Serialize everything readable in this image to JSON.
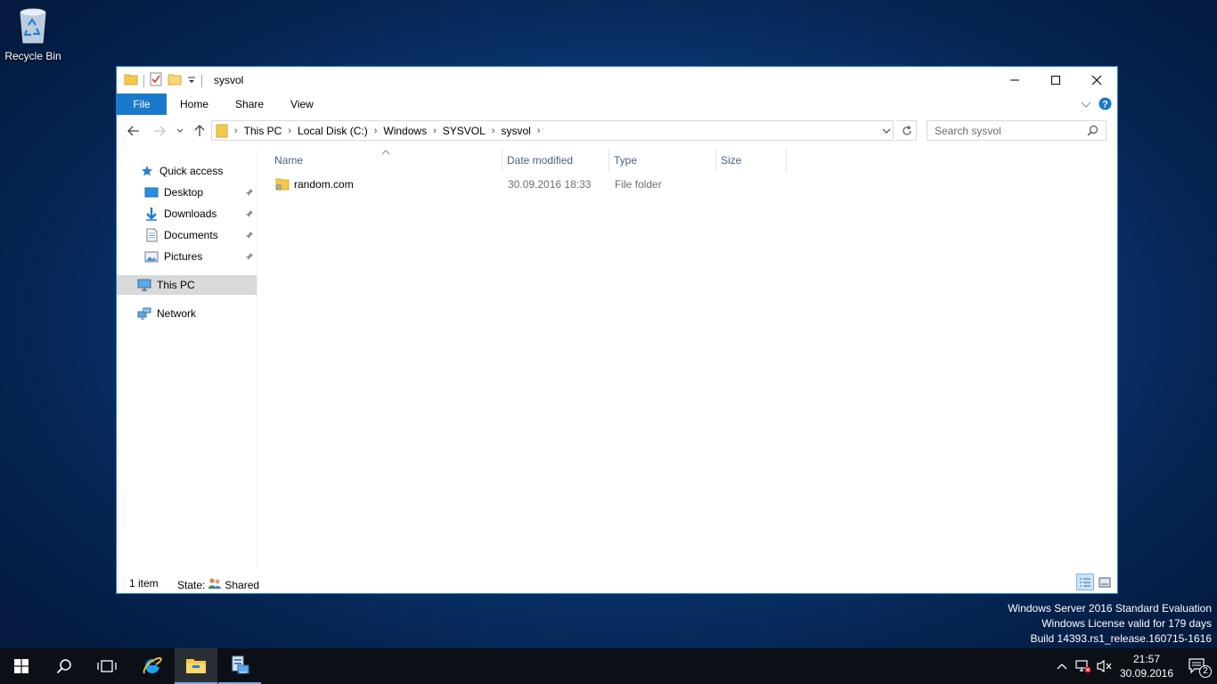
{
  "desktop": {
    "recycle_bin_label": "Recycle Bin",
    "watermark": {
      "line1": "Windows Server 2016 Standard Evaluation",
      "line2": "Windows License valid for 179 days",
      "line3": "Build 14393.rs1_release.160715-1616"
    }
  },
  "window": {
    "title": "sysvol",
    "ribbon_tabs": [
      "File",
      "Home",
      "Share",
      "View"
    ],
    "breadcrumb": [
      "This PC",
      "Local Disk (C:)",
      "Windows",
      "SYSVOL",
      "sysvol"
    ],
    "search_placeholder": "Search sysvol",
    "nav": {
      "quick_access": "Quick access",
      "desktop": "Desktop",
      "downloads": "Downloads",
      "documents": "Documents",
      "pictures": "Pictures",
      "this_pc": "This PC",
      "network": "Network"
    },
    "columns": [
      "Name",
      "Date modified",
      "Type",
      "Size"
    ],
    "files": [
      {
        "name": "random.com",
        "date_modified": "30.09.2016 18:33",
        "type": "File folder",
        "size": ""
      }
    ],
    "status": {
      "item_count": "1 item",
      "state_label": "State:",
      "state_value": "Shared"
    }
  },
  "taskbar": {
    "time": "21:57",
    "date": "30.09.2016",
    "notification_count": "2"
  },
  "colors": {
    "accent": "#1979ca",
    "folder": "#f4c84a",
    "taskbar": "#0b0f16"
  }
}
